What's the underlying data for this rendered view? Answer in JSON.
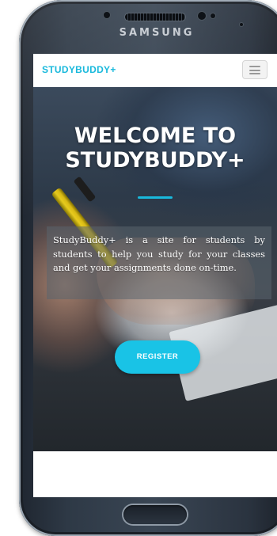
{
  "device": {
    "brand_label": "SAMSUNG"
  },
  "header": {
    "logo_text": "STUDYBUDDY+",
    "menu_icon": "hamburger-menu-icon"
  },
  "hero": {
    "title": "WELCOME TO STUDYBUDDY+",
    "description": "StudyBuddy+ is a site for students by students to help you study for your classes and get your assignments done on-time.",
    "register_label": "REGISTER"
  },
  "colors": {
    "accent": "#19b9dc",
    "button": "#19c3e6"
  }
}
